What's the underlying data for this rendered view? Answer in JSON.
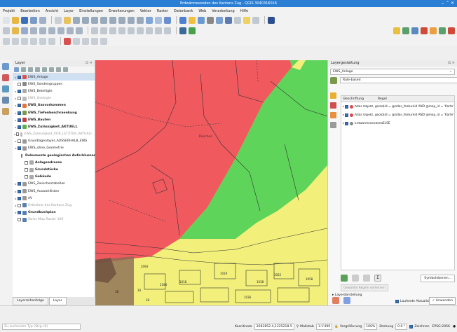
{
  "window": {
    "title": "Erdwärmesonden des Kantons Zug - QGIS 3040316016"
  },
  "menu": [
    "Projekt",
    "Bearbeiten",
    "Ansicht",
    "Layer",
    "Einstellungen",
    "Erweiterungen",
    "Vektor",
    "Raster",
    "Datenbank",
    "Web",
    "Verarbeitung",
    "Hilfe"
  ],
  "layer_panel": {
    "title": "Layer",
    "layers": [
      {
        "label": "EWS_Anlage",
        "checked": true,
        "bold": false,
        "selected": true,
        "indent": 0,
        "expander": "▸",
        "icon": "#d9534f"
      },
      {
        "label": "EWS_Sondengruppen",
        "checked": false,
        "bold": false,
        "selected": false,
        "indent": 0,
        "expander": "",
        "icon": "#888888"
      },
      {
        "label": "EWS_Beteiligte",
        "checked": true,
        "bold": false,
        "selected": false,
        "indent": 0,
        "expander": "▸",
        "icon": "#aaaaaa"
      },
      {
        "label": "EWS_Geologie",
        "checked": false,
        "bold": false,
        "selected": false,
        "indent": 0,
        "expander": "▸",
        "icon": "#bbbbbb",
        "grey": true
      },
      {
        "label": "EWS_Gasvorkommen",
        "checked": true,
        "bold": true,
        "selected": false,
        "indent": 0,
        "expander": "▸",
        "icon": "#e8733a"
      },
      {
        "label": "EWS_Tiefenbeschraenkung",
        "checked": true,
        "bold": true,
        "selected": false,
        "indent": 0,
        "expander": "▸",
        "icon": "#7a9a4a"
      },
      {
        "label": "EWS_Bauten",
        "checked": true,
        "bold": true,
        "selected": false,
        "indent": 0,
        "expander": "▸",
        "icon": "#c04040"
      },
      {
        "label": "EWS_Zulässigkeit_AKTUELL",
        "checked": true,
        "bold": true,
        "selected": false,
        "indent": 0,
        "expander": "▸",
        "icon": "#5ab04a"
      },
      {
        "label": "EWS_Zulässigkeit_VOR_LETZTER_AKTUALI...",
        "checked": false,
        "bold": false,
        "selected": false,
        "indent": 0,
        "expander": "▸",
        "icon": "#bbbbbb",
        "grey": true
      },
      {
        "label": "Grundlagenlayer_AUSSERHALB_EWS",
        "checked": false,
        "bold": false,
        "selected": false,
        "indent": 0,
        "expander": "▸",
        "icon": "#999999"
      },
      {
        "label": "EWS_ohne_Geometrie",
        "checked": true,
        "bold": false,
        "selected": false,
        "indent": 0,
        "expander": "▾",
        "icon": "#999999"
      },
      {
        "label": "Dokumente geologisches Aufschlussarchiv",
        "checked": false,
        "bold": true,
        "selected": false,
        "indent": 1,
        "expander": "",
        "icon": "#aaaaaa"
      },
      {
        "label": "Anlageadresse",
        "checked": false,
        "bold": true,
        "selected": false,
        "indent": 1,
        "expander": "",
        "icon": "#aaaaaa"
      },
      {
        "label": "Grundstücke",
        "checked": false,
        "bold": true,
        "selected": false,
        "indent": 1,
        "expander": "",
        "icon": "#aaaaaa"
      },
      {
        "label": "Gebäude",
        "checked": false,
        "bold": true,
        "selected": false,
        "indent": 1,
        "expander": "",
        "icon": "#aaaaaa"
      },
      {
        "label": "EWS_Zwischentabellen",
        "checked": true,
        "bold": false,
        "selected": false,
        "indent": 0,
        "expander": "▸",
        "icon": "#999999"
      },
      {
        "label": "EWS_Auswahllisten",
        "checked": true,
        "bold": false,
        "selected": false,
        "indent": 0,
        "expander": "▸",
        "icon": "#999999"
      },
      {
        "label": "AV",
        "checked": true,
        "bold": false,
        "selected": false,
        "indent": 0,
        "expander": "▸",
        "icon": "#999999"
      },
      {
        "label": "Orthofoto des Kantons Zug",
        "checked": false,
        "bold": false,
        "selected": false,
        "indent": 0,
        "expander": "▸",
        "icon": "#5a80b0",
        "grey": true
      },
      {
        "label": "Grundbuchplan",
        "checked": true,
        "bold": true,
        "selected": false,
        "indent": 0,
        "expander": "▸",
        "icon": "#5a80b0"
      },
      {
        "label": "Swiss Map Raster 100",
        "checked": false,
        "bold": false,
        "selected": false,
        "indent": 0,
        "expander": "",
        "icon": "#5a80b0",
        "grey": true
      }
    ],
    "tabs": [
      "Layerreihenfolge",
      "Layer"
    ]
  },
  "map": {
    "place_labels": [
      "Rüschen"
    ],
    "parcel_numbers": [
      "2093",
      "2184",
      "1018",
      "1019",
      "18",
      "1022",
      "1038",
      "1058",
      "1036",
      "34",
      "28"
    ],
    "colors": {
      "red": "#f0595e",
      "green": "#5fd45a",
      "yellow": "#f2f07a"
    }
  },
  "style_panel": {
    "title": "Layergestaltung",
    "layer_combo": "EWS_Anlage",
    "renderer_combo": "Rule-based",
    "col_label": "Beschriftung",
    "col_rule": "Regel",
    "rules": [
      {
        "label": "Atlas Objekt, geolog...",
        "rule": "$id = @atlas_featureid AND @map_id = 'Karte'"
      },
      {
        "label": "Atlas Objekt, geolog...",
        "rule": "$id = @atlas_featureid AND @map_id = 'Karte'"
      },
      {
        "label": "Erdwärmesondenanlag...",
        "rule": "ELSE"
      }
    ],
    "refine_label": "Gewählte Regeln verfeinern",
    "symbol_levels_label": "Symbolebenen...",
    "layer_rendering_label": "Layerdarstellung",
    "live_update_label": "Laufende Aktualisierung",
    "apply_label": "✓ Anwenden"
  },
  "status": {
    "search_placeholder": "Zu suchender Typ (Strg+K)",
    "coord_label": "Koordinate",
    "coord_value": "2682852.4,1225218.5",
    "scale_label": "Maßstab",
    "scale_value": "1:1'499",
    "magnifier_label": "Vergrößerung",
    "magnifier_value": "100%",
    "rotation_label": "Drehung",
    "rotation_value": "0.0 °",
    "render_label": "Zeichnen",
    "crs_label": "EPSG:2056"
  }
}
